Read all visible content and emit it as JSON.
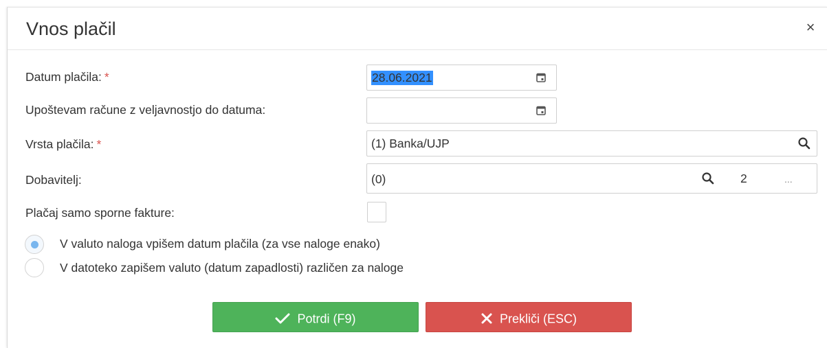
{
  "dialog": {
    "title": "Vnos plačil",
    "close_symbol": "×"
  },
  "form": {
    "payment_date": {
      "label": "Datum plačila:",
      "required_mark": "*",
      "value": "28.06.2021",
      "icon": "calendar-icon"
    },
    "validity_date": {
      "label": "Upoštevam račune z veljavnostjo do datuma:",
      "value": "",
      "icon": "calendar-icon"
    },
    "payment_type": {
      "label": "Vrsta plačila:",
      "required_mark": "*",
      "value": "(1) Banka/UJP",
      "icon": "search-icon"
    },
    "supplier": {
      "label": "Dobavitelj:",
      "value": "(0)",
      "count": "2",
      "more": "...",
      "icon": "search-icon"
    },
    "disputed_only": {
      "label": "Plačaj samo sporne fakture:",
      "checked": false
    }
  },
  "radios": [
    {
      "label": "V valuto naloga vpišem datum plačila (za vse naloge enako)",
      "checked": true
    },
    {
      "label": "V datoteko zapišem valuto (datum zapadlosti) različen za naloge",
      "checked": false
    }
  ],
  "buttons": {
    "confirm_label": "Potrdi (F9)",
    "cancel_label": "Prekliči (ESC)"
  },
  "colors": {
    "confirm": "#4eb35a",
    "cancel": "#d9534f",
    "required": "#d9534f",
    "selection": "#3390ff",
    "radio_dot": "#79b6ee"
  }
}
